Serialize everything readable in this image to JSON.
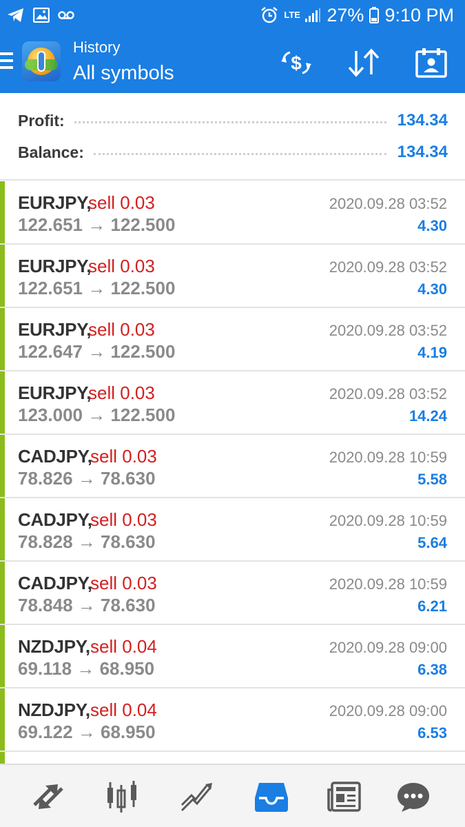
{
  "status_bar": {
    "lte": "LTE",
    "battery": "27%",
    "time": "9:10 PM",
    "icons": [
      "telegram-icon",
      "gallery-icon",
      "voicemail-icon",
      "alarm-icon",
      "signal-icon",
      "battery-icon"
    ]
  },
  "header": {
    "subtitle": "History",
    "title": "All symbols",
    "actions": [
      "currency-exchange-icon",
      "sort-icon",
      "calendar-icon"
    ]
  },
  "summary": {
    "profit_label": "Profit:",
    "profit_value": "134.34",
    "balance_label": "Balance:",
    "balance_value": "134.34"
  },
  "deals": [
    {
      "symbol": "EURJPY,",
      "side": "sell 0.03",
      "open": "122.651",
      "close": "122.500",
      "time": "2020.09.28 03:52",
      "profit": "4.30"
    },
    {
      "symbol": "EURJPY,",
      "side": "sell 0.03",
      "open": "122.651",
      "close": "122.500",
      "time": "2020.09.28 03:52",
      "profit": "4.30"
    },
    {
      "symbol": "EURJPY,",
      "side": "sell 0.03",
      "open": "122.647",
      "close": "122.500",
      "time": "2020.09.28 03:52",
      "profit": "4.19"
    },
    {
      "symbol": "EURJPY,",
      "side": "sell 0.03",
      "open": "123.000",
      "close": "122.500",
      "time": "2020.09.28 03:52",
      "profit": "14.24"
    },
    {
      "symbol": "CADJPY,",
      "side": "sell 0.03",
      "open": "78.826",
      "close": "78.630",
      "time": "2020.09.28 10:59",
      "profit": "5.58"
    },
    {
      "symbol": "CADJPY,",
      "side": "sell 0.03",
      "open": "78.828",
      "close": "78.630",
      "time": "2020.09.28 10:59",
      "profit": "5.64"
    },
    {
      "symbol": "CADJPY,",
      "side": "sell 0.03",
      "open": "78.848",
      "close": "78.630",
      "time": "2020.09.28 10:59",
      "profit": "6.21"
    },
    {
      "symbol": "NZDJPY,",
      "side": "sell 0.04",
      "open": "69.118",
      "close": "68.950",
      "time": "2020.09.28 09:00",
      "profit": "6.38"
    },
    {
      "symbol": "NZDJPY,",
      "side": "sell 0.04",
      "open": "69.122",
      "close": "68.950",
      "time": "2020.09.28 09:00",
      "profit": "6.53"
    }
  ],
  "bottom_nav": [
    "quotes-icon",
    "chart-icon",
    "trade-icon",
    "history-icon",
    "news-icon",
    "messages-icon"
  ],
  "colors": {
    "primary": "#1a7ee3",
    "sell": "#d32020",
    "stripe": "#8bbc1c",
    "nav_icon": "#5a5a5a",
    "nav_active": "#1a7ee3"
  }
}
